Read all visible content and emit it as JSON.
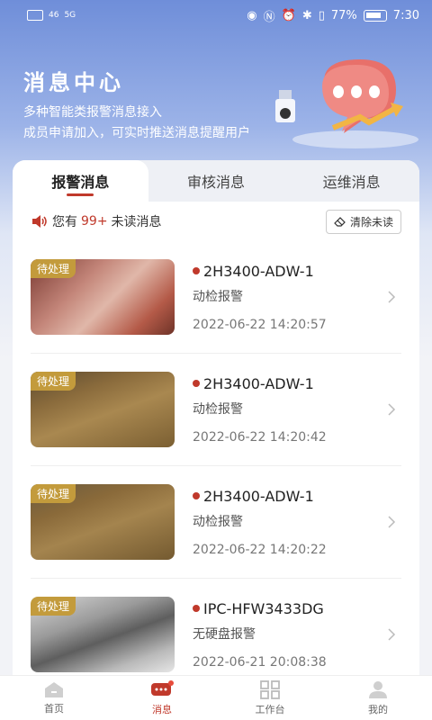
{
  "status_bar": {
    "left_labels": [
      "46",
      "5G"
    ],
    "battery": "77%",
    "time": "7:30"
  },
  "hero": {
    "title": "消息中心",
    "subtitle_line1": "多种智能类报警消息接入",
    "subtitle_line2": "成员申请加入，可实时推送消息提醒用户"
  },
  "tabs": [
    {
      "label": "报警消息",
      "active": true
    },
    {
      "label": "审核消息",
      "active": false
    },
    {
      "label": "运维消息",
      "active": false
    }
  ],
  "notice": {
    "prefix": "您有",
    "count": "99+",
    "suffix": "未读消息",
    "clear_label": "清除未读"
  },
  "messages": [
    {
      "badge": "待处理",
      "device": "2H3400-ADW-1",
      "type": "动检报警",
      "time": "2022-06-22 14:20:57",
      "thumb_color": "#b5675a"
    },
    {
      "badge": "待处理",
      "device": "2H3400-ADW-1",
      "type": "动检报警",
      "time": "2022-06-22 14:20:42",
      "thumb_color": "#8a6b3c"
    },
    {
      "badge": "待处理",
      "device": "2H3400-ADW-1",
      "type": "动检报警",
      "time": "2022-06-22 14:20:22",
      "thumb_color": "#8a6a3a"
    },
    {
      "badge": "待处理",
      "device": "IPC-HFW3433DG",
      "type": "无硬盘报警",
      "time": "2022-06-21 20:08:38",
      "thumb_color": "#9a9a9a"
    }
  ],
  "bottom_nav": [
    {
      "label": "首页",
      "icon": "home-icon",
      "active": false
    },
    {
      "label": "消息",
      "icon": "message-icon",
      "active": true
    },
    {
      "label": "工作台",
      "icon": "grid-icon",
      "active": false
    },
    {
      "label": "我的",
      "icon": "user-icon",
      "active": false
    }
  ],
  "colors": {
    "accent": "#c0392b",
    "badge": "#c39b3c"
  }
}
